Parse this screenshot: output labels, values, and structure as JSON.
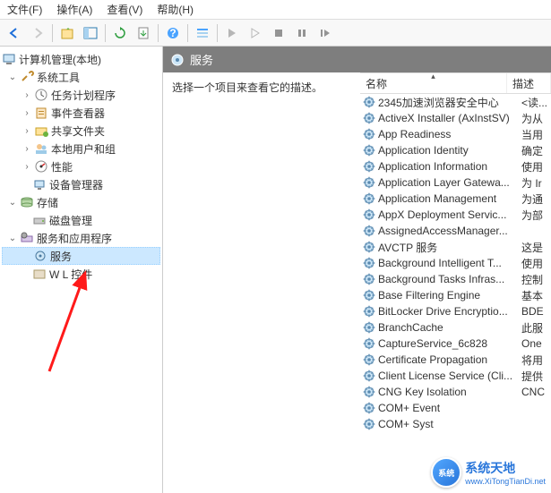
{
  "menu": {
    "file": "文件(F)",
    "action": "操作(A)",
    "view": "查看(V)",
    "help": "帮助(H)"
  },
  "tree": {
    "root": "计算机管理(本地)",
    "system_tools": "系统工具",
    "task_scheduler": "任务计划程序",
    "event_viewer": "事件查看器",
    "shared_folders": "共享文件夹",
    "local_users": "本地用户和组",
    "performance": "性能",
    "device_manager": "设备管理器",
    "storage": "存储",
    "disk_management": "磁盘管理",
    "services_apps": "服务和应用程序",
    "services": "服务",
    "wmi": "W      L 控件"
  },
  "header": {
    "title": "服务"
  },
  "desc": {
    "prompt": "选择一个项目来查看它的描述。"
  },
  "columns": {
    "name": "名称",
    "desc": "描述"
  },
  "services": [
    {
      "n": "2345加速浏览器安全中心",
      "d": "<读..."
    },
    {
      "n": "ActiveX Installer (AxInstSV)",
      "d": "为从"
    },
    {
      "n": "App Readiness",
      "d": "当用"
    },
    {
      "n": "Application Identity",
      "d": "确定"
    },
    {
      "n": "Application Information",
      "d": "使用"
    },
    {
      "n": "Application Layer Gatewa...",
      "d": "为 Ir"
    },
    {
      "n": "Application Management",
      "d": "为通"
    },
    {
      "n": "AppX Deployment Servic...",
      "d": "为部"
    },
    {
      "n": "AssignedAccessManager...",
      "d": ""
    },
    {
      "n": "AVCTP 服务",
      "d": "这是"
    },
    {
      "n": "Background Intelligent T...",
      "d": "使用"
    },
    {
      "n": "Background Tasks Infras...",
      "d": "控制"
    },
    {
      "n": "Base Filtering Engine",
      "d": "基本"
    },
    {
      "n": "BitLocker Drive Encryptio...",
      "d": "BDE"
    },
    {
      "n": "BranchCache",
      "d": "此服"
    },
    {
      "n": "CaptureService_6c828",
      "d": "One"
    },
    {
      "n": "Certificate Propagation",
      "d": "将用"
    },
    {
      "n": "Client License Service (Cli...",
      "d": "提供"
    },
    {
      "n": "CNG Key Isolation",
      "d": "CNC"
    },
    {
      "n": "COM+ Event",
      "d": ""
    },
    {
      "n": "COM+ Syst",
      "d": ""
    }
  ],
  "watermark": {
    "main": "系统天地",
    "sub": "www.XiTongTianDi.net",
    "badge": "系统"
  }
}
